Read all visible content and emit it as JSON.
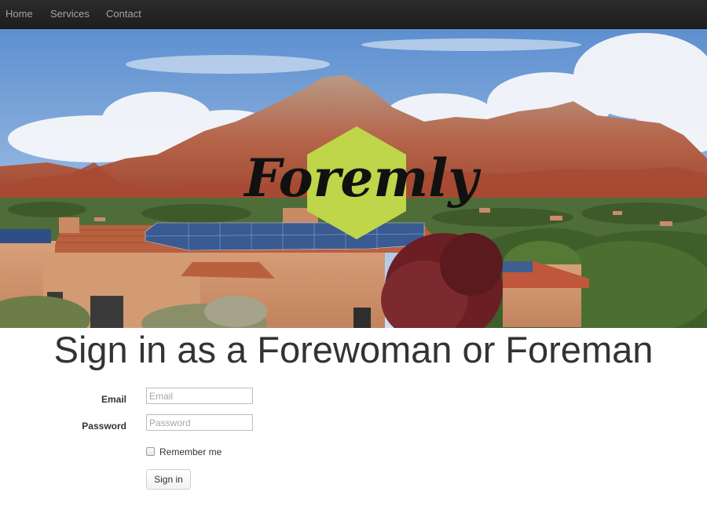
{
  "nav": {
    "items": [
      {
        "label": "Home"
      },
      {
        "label": "Services"
      },
      {
        "label": "Contact"
      }
    ]
  },
  "hero": {
    "logo_text": "Foremly",
    "logo_color": "#bfd54a"
  },
  "page": {
    "title": "Sign in as a Forewoman or Foreman"
  },
  "form": {
    "email_label": "Email",
    "email_placeholder": "Email",
    "email_value": "",
    "password_label": "Password",
    "password_placeholder": "Password",
    "password_value": "",
    "remember_label": "Remember me",
    "remember_checked": false,
    "submit_label": "Sign in"
  }
}
